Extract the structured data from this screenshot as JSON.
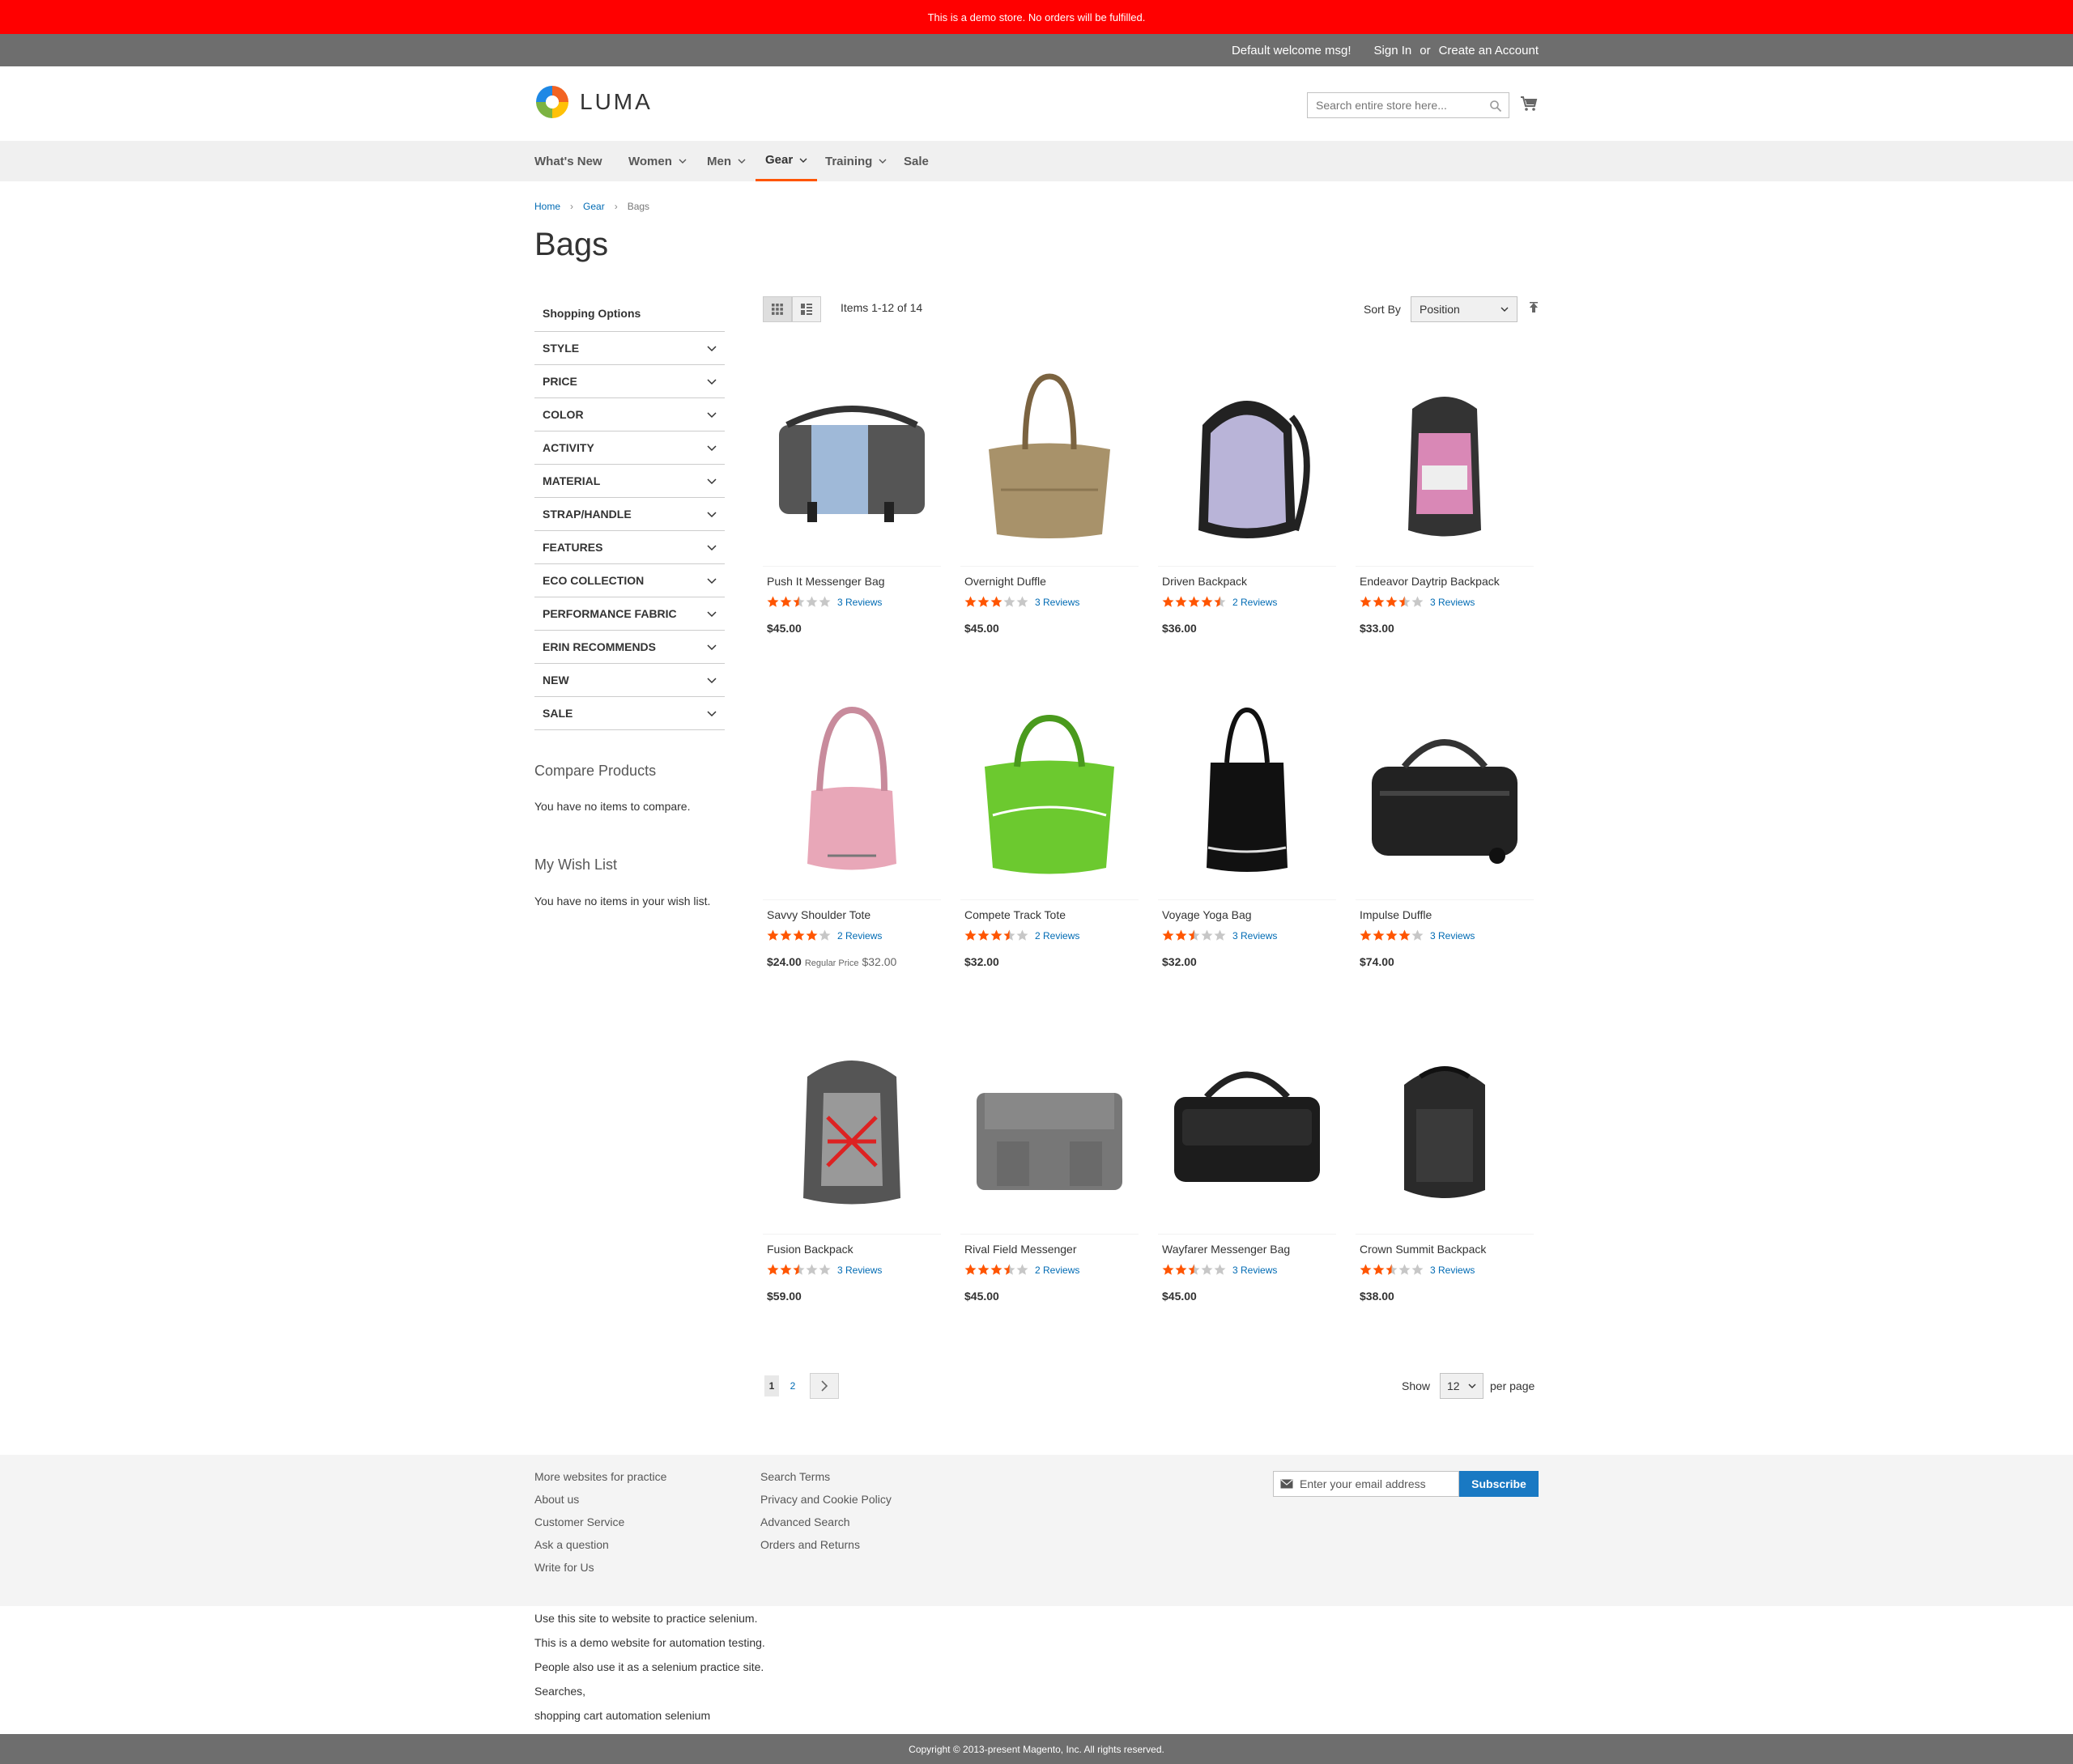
{
  "demo_notice": "This is a demo store. No orders will be fulfilled.",
  "topbar": {
    "welcome": "Default welcome msg!",
    "sign_in": "Sign In",
    "or": "or",
    "create_account": "Create an Account"
  },
  "brand": {
    "name": "LUMA"
  },
  "search": {
    "placeholder": "Search entire store here..."
  },
  "nav": [
    {
      "label": "What's New",
      "dropdown": false
    },
    {
      "label": "Women",
      "dropdown": true
    },
    {
      "label": "Men",
      "dropdown": true
    },
    {
      "label": "Gear",
      "dropdown": true,
      "active": true
    },
    {
      "label": "Training",
      "dropdown": true
    },
    {
      "label": "Sale",
      "dropdown": false
    }
  ],
  "breadcrumb": {
    "home": "Home",
    "gear": "Gear",
    "current": "Bags"
  },
  "page_title": "Bags",
  "sidebar": {
    "title": "Shopping Options",
    "filters": [
      "STYLE",
      "PRICE",
      "COLOR",
      "ACTIVITY",
      "MATERIAL",
      "STRAP/HANDLE",
      "FEATURES",
      "ECO COLLECTION",
      "PERFORMANCE FABRIC",
      "ERIN RECOMMENDS",
      "NEW",
      "SALE"
    ],
    "compare_title": "Compare Products",
    "compare_text": "You have no items to compare.",
    "wishlist_title": "My Wish List",
    "wishlist_text": "You have no items in your wish list."
  },
  "toolbar": {
    "amount": "Items 1-12 of 14",
    "sort_label": "Sort By",
    "sort_value": "Position"
  },
  "products": [
    {
      "name": "Push It Messenger Bag",
      "rating": 2.5,
      "reviews": "3 Reviews",
      "price": "$45.00"
    },
    {
      "name": "Overnight Duffle",
      "rating": 3,
      "reviews": "3 Reviews",
      "price": "$45.00"
    },
    {
      "name": "Driven Backpack",
      "rating": 4.5,
      "reviews": "2 Reviews",
      "price": "$36.00"
    },
    {
      "name": "Endeavor Daytrip Backpack",
      "rating": 3.5,
      "reviews": "3 Reviews",
      "price": "$33.00"
    },
    {
      "name": "Savvy Shoulder Tote",
      "rating": 4,
      "reviews": "2 Reviews",
      "price": "$24.00",
      "regular_label": "Regular Price",
      "regular_price": "$32.00"
    },
    {
      "name": "Compete Track Tote",
      "rating": 3.5,
      "reviews": "2 Reviews",
      "price": "$32.00"
    },
    {
      "name": "Voyage Yoga Bag",
      "rating": 2.5,
      "reviews": "3 Reviews",
      "price": "$32.00"
    },
    {
      "name": "Impulse Duffle",
      "rating": 4,
      "reviews": "3 Reviews",
      "price": "$74.00"
    },
    {
      "name": "Fusion Backpack",
      "rating": 2.5,
      "reviews": "3 Reviews",
      "price": "$59.00"
    },
    {
      "name": "Rival Field Messenger",
      "rating": 3.5,
      "reviews": "2 Reviews",
      "price": "$45.00"
    },
    {
      "name": "Wayfarer Messenger Bag",
      "rating": 2.5,
      "reviews": "3 Reviews",
      "price": "$45.00"
    },
    {
      "name": "Crown Summit Backpack",
      "rating": 2.5,
      "reviews": "3 Reviews",
      "price": "$38.00"
    }
  ],
  "pager": {
    "current": "1",
    "next_page": "2",
    "show_label": "Show",
    "limit": "12",
    "per_page": "per page"
  },
  "footer": {
    "col1": [
      "More websites for practice",
      "About us",
      "Customer Service",
      "Ask a question",
      "Write for Us"
    ],
    "col2": [
      "Search Terms",
      "Privacy and Cookie Policy",
      "Advanced Search",
      "Orders and Returns"
    ],
    "newsletter_placeholder": "Enter your email address",
    "subscribe": "Subscribe"
  },
  "extra_text": [
    "Use this site to website to practice selenium.",
    "This is a demo website for automation testing.",
    "People also use it as a selenium practice site.",
    "Searches,",
    "shopping cart automation selenium"
  ],
  "copyright": "Copyright © 2013-present Magento, Inc. All rights reserved.",
  "colors": {
    "accent": "#ff5501",
    "link": "#006bb4",
    "button": "#1979c3",
    "notice": "#ff0000"
  }
}
